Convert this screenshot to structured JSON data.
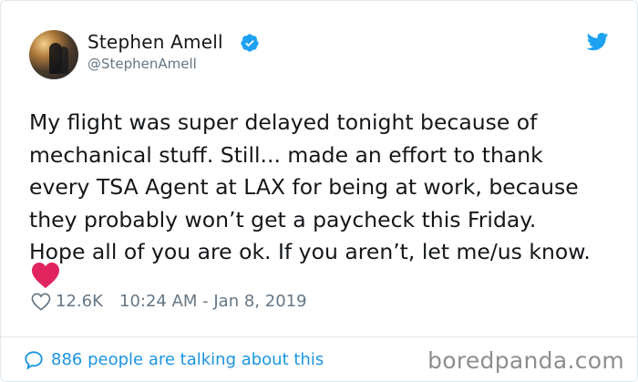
{
  "user": {
    "name": "Stephen Amell",
    "handle": "@StephenAmell"
  },
  "tweet": {
    "text": "My flight was super delayed tonight because of\nmechanical stuff. Still... made an effort to thank\nevery TSA Agent at LAX for being at work, because\nthey probably won’t get a paycheck this Friday.\nHope all of you are ok. If you aren’t, let me/us know.",
    "emoji": "red-heart"
  },
  "meta": {
    "likes": "12.6K",
    "timestamp": "10:24 AM - Jan 8, 2019"
  },
  "footer": {
    "talking": "886 people are talking about this"
  },
  "watermark": "boredpanda.com",
  "colors": {
    "verified": "#1da1f2",
    "bird": "#1da1f2",
    "link": "#1b95e0",
    "heart": "#e0245e",
    "muted": "#657786"
  }
}
